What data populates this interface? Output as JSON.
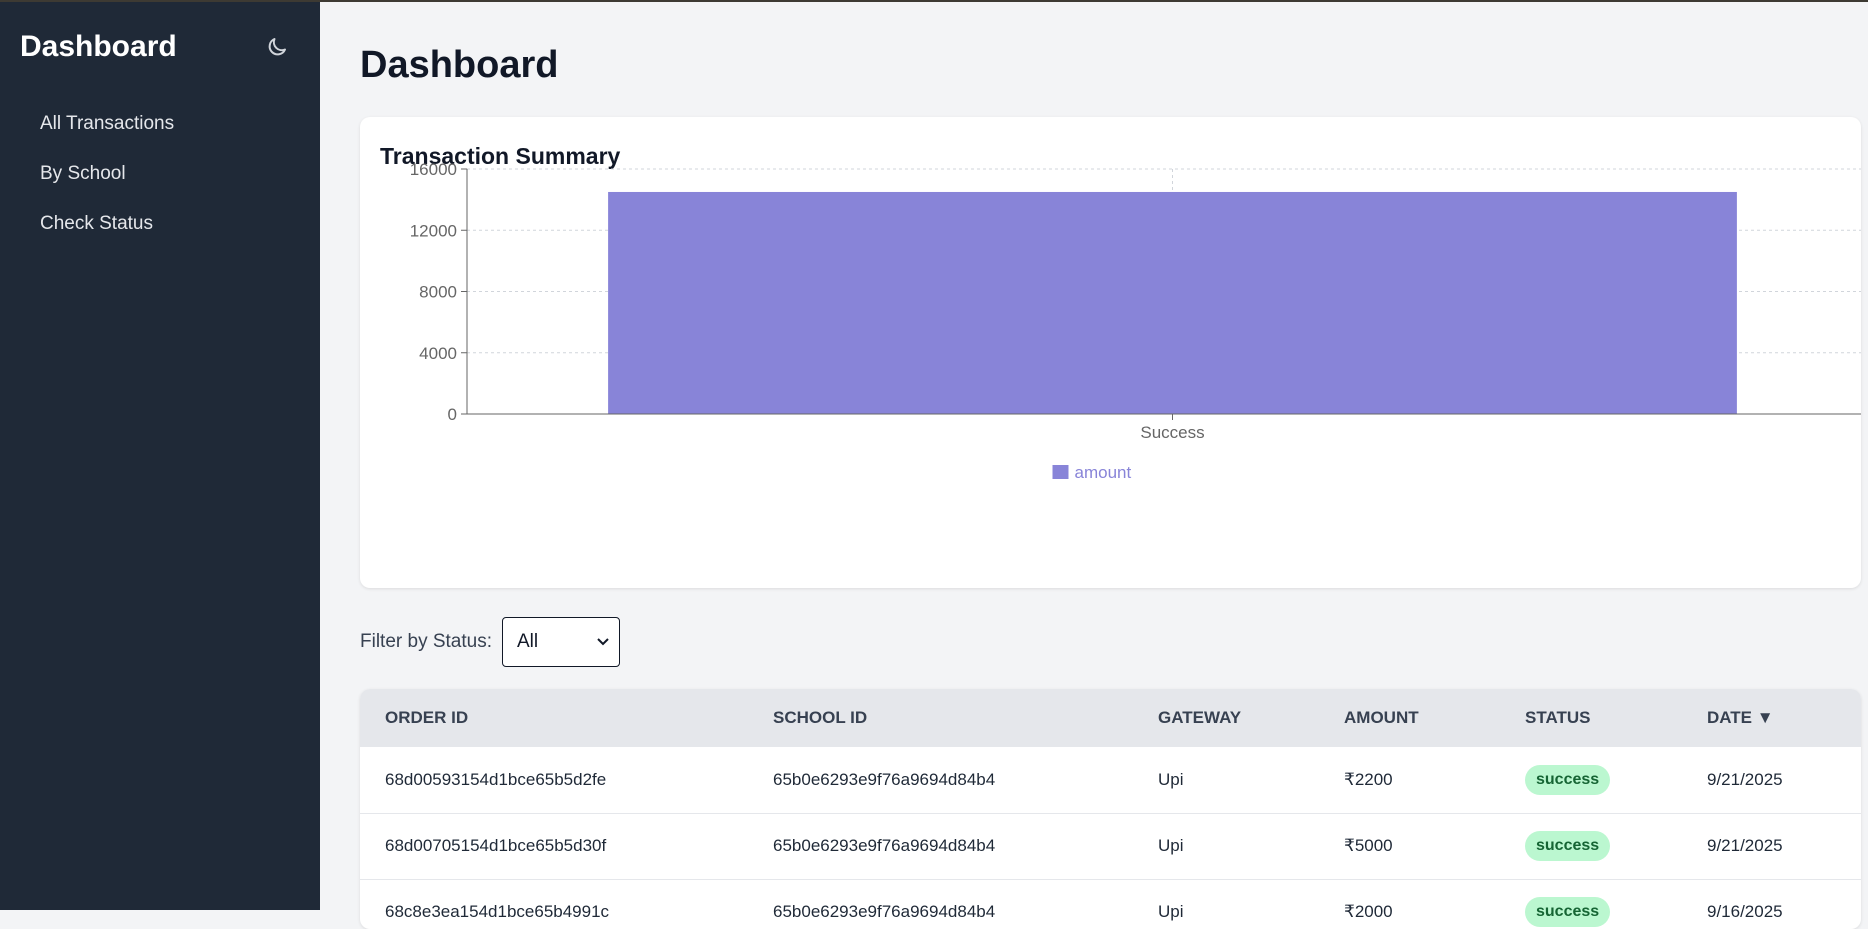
{
  "sidebar": {
    "brand": "Dashboard",
    "theme_icon": "moon-icon",
    "items": [
      {
        "label": "All Transactions"
      },
      {
        "label": "By School"
      },
      {
        "label": "Check Status"
      }
    ]
  },
  "main": {
    "title": "Dashboard",
    "summary": {
      "title": "Transaction Summary"
    },
    "filter": {
      "label": "Filter by Status:",
      "selected": "All"
    },
    "table": {
      "headers": [
        "ORDER ID",
        "SCHOOL ID",
        "GATEWAY",
        "AMOUNT",
        "STATUS",
        "DATE ▼"
      ],
      "rows": [
        {
          "order_id": "68d00593154d1bce65b5d2fe",
          "school_id": "65b0e6293e9f76a9694d84b4",
          "gateway": "Upi",
          "amount": "₹2200",
          "status": "success",
          "date": "9/21/2025"
        },
        {
          "order_id": "68d00705154d1bce65b5d30f",
          "school_id": "65b0e6293e9f76a9694d84b4",
          "gateway": "Upi",
          "amount": "₹5000",
          "status": "success",
          "date": "9/21/2025"
        },
        {
          "order_id": "68c8e3ea154d1bce65b4991c",
          "school_id": "65b0e6293e9f76a9694d84b4",
          "gateway": "Upi",
          "amount": "₹2000",
          "status": "success",
          "date": "9/16/2025"
        }
      ]
    }
  },
  "colors": {
    "sidebar_bg": "#1f2937",
    "bar": "#8884d8",
    "badge_bg": "#bbf7d0",
    "badge_text": "#166534"
  },
  "chart_data": {
    "type": "bar",
    "categories": [
      "Success"
    ],
    "series": [
      {
        "name": "amount",
        "values": [
          14500
        ]
      }
    ],
    "ylim": [
      0,
      16000
    ],
    "yticks": [
      0,
      4000,
      8000,
      12000,
      16000
    ],
    "grid": true,
    "legend": "bottom-center"
  }
}
